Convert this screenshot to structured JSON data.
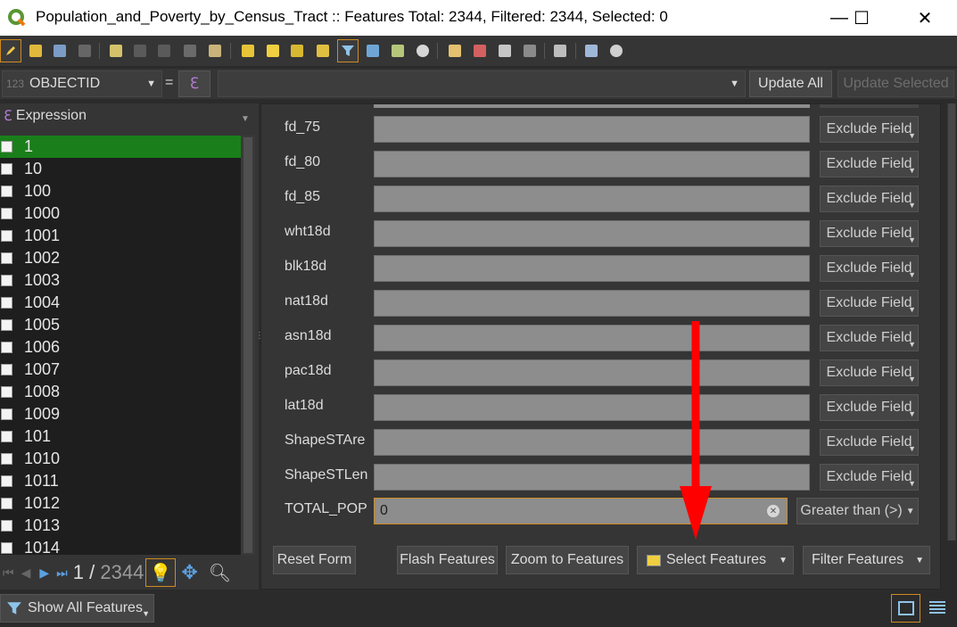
{
  "window": {
    "title": "Population_and_Poverty_by_Census_Tract :: Features Total: 2344, Filtered: 2344, Selected: 0",
    "minimize": "—",
    "maximize": "☐",
    "close": "✕"
  },
  "fieldbar": {
    "field_type": "123",
    "field_name": "OBJECTID",
    "equals": "=",
    "update_all": "Update All",
    "update_selected": "Update Selected"
  },
  "left": {
    "expression_label": "Expression",
    "rows": [
      "1",
      "10",
      "100",
      "1000",
      "1001",
      "1002",
      "1003",
      "1004",
      "1005",
      "1006",
      "1007",
      "1008",
      "1009",
      "101",
      "1010",
      "1011",
      "1012",
      "1013",
      "1014"
    ],
    "selected_row": "1",
    "nav_current": "1",
    "nav_sep": " / ",
    "nav_total": "2344"
  },
  "form": {
    "fields": [
      {
        "label": "fd_75",
        "action": "Exclude Field"
      },
      {
        "label": "fd_80",
        "action": "Exclude Field"
      },
      {
        "label": "fd_85",
        "action": "Exclude Field"
      },
      {
        "label": "wht18d",
        "action": "Exclude Field"
      },
      {
        "label": "blk18d",
        "action": "Exclude Field"
      },
      {
        "label": "nat18d",
        "action": "Exclude Field"
      },
      {
        "label": "asn18d",
        "action": "Exclude Field"
      },
      {
        "label": "pac18d",
        "action": "Exclude Field"
      },
      {
        "label": "lat18d",
        "action": "Exclude Field"
      },
      {
        "label": "ShapeSTAre",
        "action": "Exclude Field"
      },
      {
        "label": "ShapeSTLen",
        "action": "Exclude Field"
      }
    ],
    "active_field": {
      "label": "TOTAL_POP",
      "value": "0",
      "action": "Greater than (>)"
    },
    "buttons": {
      "reset": "Reset Form",
      "flash": "Flash Features",
      "zoom": "Zoom to Features",
      "select": "Select Features",
      "filter": "Filter Features"
    }
  },
  "bottom": {
    "show_all": "Show All Features"
  },
  "colors": {
    "accent": "#d08a1f",
    "selection": "#1a7f1a",
    "arrow": "#ff0000"
  }
}
